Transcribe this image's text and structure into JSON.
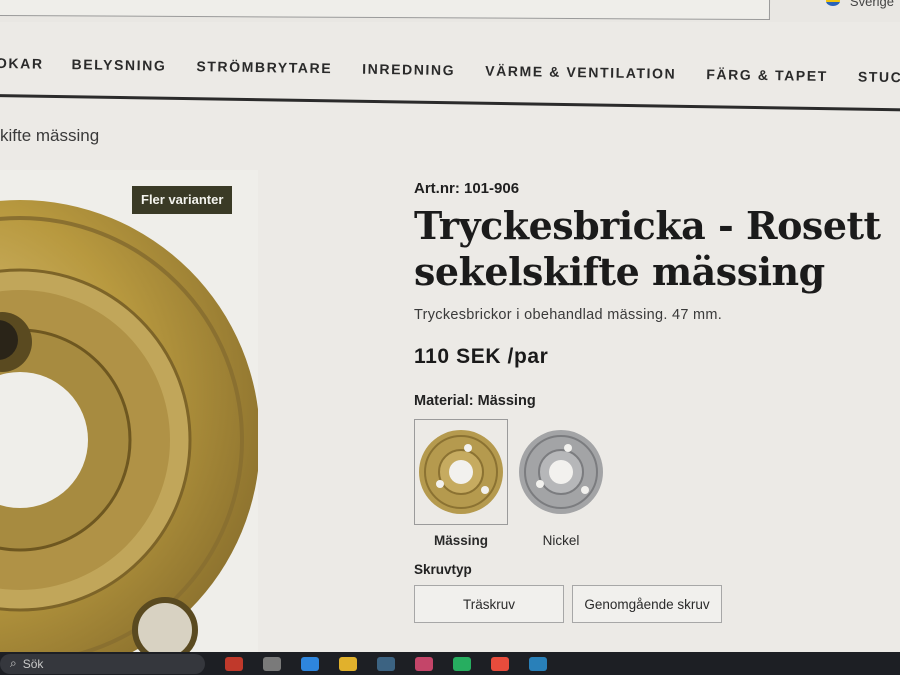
{
  "header": {
    "language_label": "Sverige"
  },
  "nav": {
    "items": [
      {
        "label": "OKAR"
      },
      {
        "label": "BELYSNING"
      },
      {
        "label": "STRÖMBRYTARE"
      },
      {
        "label": "INREDNING"
      },
      {
        "label": "VÄRME & VENTILATION"
      },
      {
        "label": "FÄRG & TAPET"
      },
      {
        "label": "STUCKATUR"
      }
    ]
  },
  "breadcrumb": {
    "current": "kifte mässing"
  },
  "product": {
    "badge": "Fler varianter",
    "article_number": "Art.nr: 101-906",
    "title": "Tryckesbricka - Rosett sekelskifte mässing",
    "description": "Tryckesbrickor i obehandlad mässing. 47 mm.",
    "price": "110 SEK /par",
    "material_label": "Material: Mässing",
    "materials": [
      {
        "label": "Mässing",
        "selected": true,
        "color": "#b59a4e"
      },
      {
        "label": "Nickel",
        "selected": false,
        "color": "#a3a4a6"
      }
    ],
    "screw_label": "Skruvtyp",
    "screw_options": [
      {
        "label": "Träskruv"
      },
      {
        "label": "Genomgående skruv"
      }
    ]
  },
  "taskbar": {
    "search_placeholder": "Sök"
  },
  "colors": {
    "badge_bg": "#3a3a26",
    "brass": "#b59a4e",
    "nickel": "#a3a4a6",
    "taskbar_bg": "#1d1f24"
  }
}
